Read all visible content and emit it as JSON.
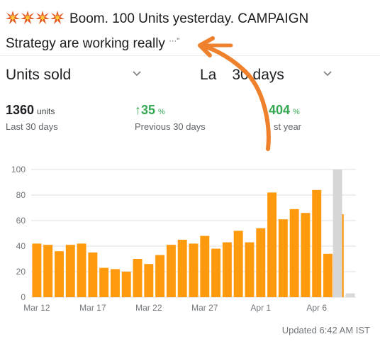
{
  "post": {
    "line1": "Boom. 100 Units yesterday. CAMPAIGN",
    "line2": "Strategy are working really",
    "truncated_tail": "···\""
  },
  "header": {
    "metric_label": "Units sold",
    "range_label_left": "La",
    "range_label_right": "30 days"
  },
  "stats": [
    {
      "value": "1360",
      "unit": "units",
      "label": "Last 30 days"
    },
    {
      "arrow": "↑",
      "value": "35",
      "unit": "%",
      "label": "Previous 30 days"
    },
    {
      "arrow": "↑",
      "value": "404",
      "unit": "%",
      "label_partial": "st year"
    }
  ],
  "chart_data": {
    "type": "bar",
    "ylim": [
      0,
      100
    ],
    "y_ticks": [
      "0",
      "20",
      "40",
      "60",
      "80",
      "100"
    ],
    "x_tick_labels": [
      "Mar 12",
      "Mar 17",
      "Mar 22",
      "Mar 27",
      "Apr 1",
      "Apr 6"
    ],
    "values": [
      42,
      41,
      36,
      41,
      42,
      35,
      23,
      22,
      20,
      30,
      26,
      33,
      41,
      45,
      42,
      48,
      38,
      43,
      52,
      43,
      54,
      82,
      61,
      69,
      66,
      84,
      34,
      65
    ],
    "current_day_value": 3,
    "bar_color": "#ff9a0f",
    "current_bar_color": "#d9d9d9",
    "grid": true
  },
  "footer": {
    "updated": "Updated 6:42 AM IST"
  },
  "colors": {
    "arrow": "#f0812c",
    "positive": "#34a853",
    "emoji_star": "#e25822"
  },
  "icons": [
    "collision-emoji-icon",
    "chevron-down-icon",
    "arrow-up-icon",
    "hand-drawn-arrow-icon"
  ]
}
